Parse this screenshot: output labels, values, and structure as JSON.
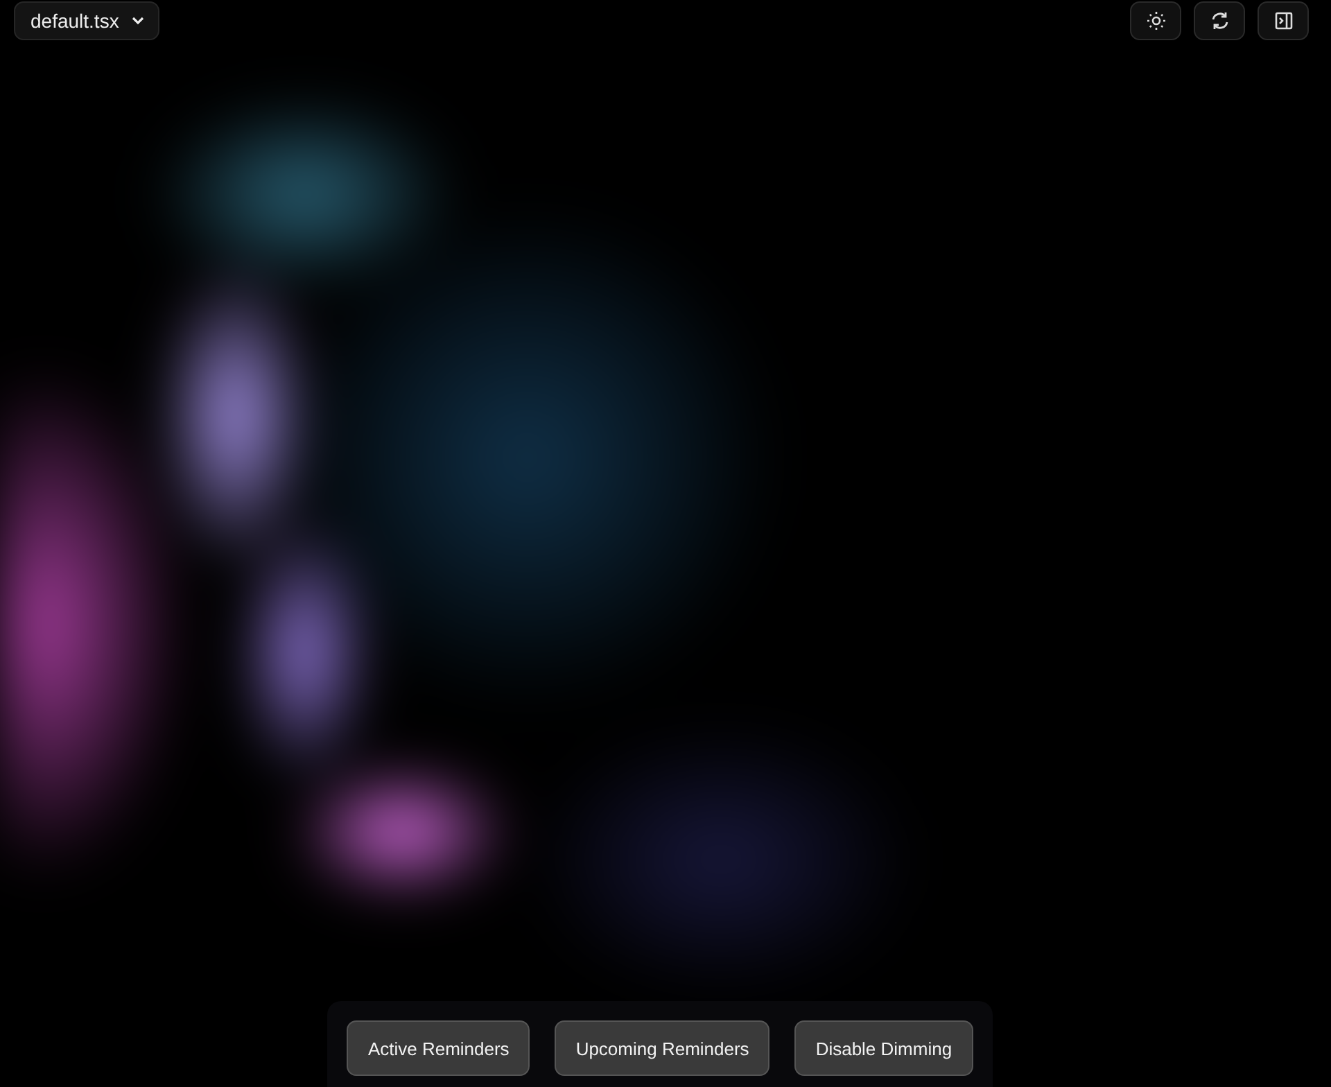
{
  "file_selector": {
    "label": "default.tsx"
  },
  "toolbar_buttons": [
    {
      "kind": "theme"
    },
    {
      "kind": "refresh"
    },
    {
      "kind": "panel"
    }
  ],
  "actions": [
    {
      "label": "Active Reminders"
    },
    {
      "label": "Upcoming Reminders"
    },
    {
      "label": "Disable Dimming"
    }
  ]
}
